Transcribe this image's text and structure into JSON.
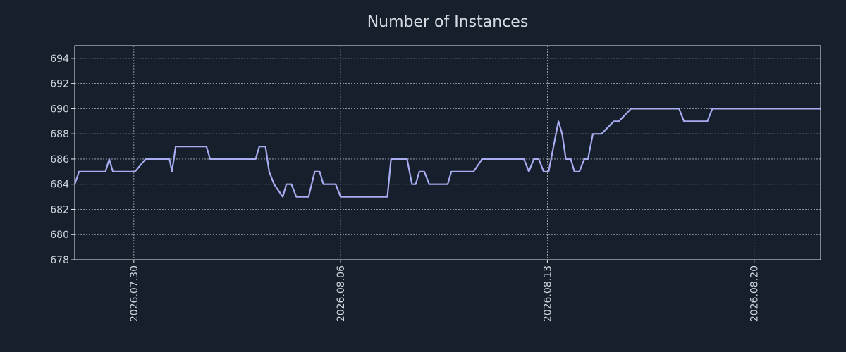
{
  "colors": {
    "background": "#161f2c",
    "line": "#a9acf0",
    "grid": "#d6dbe3",
    "axis": "#e6e9ee",
    "text": "#cfd5de"
  },
  "chart_data": {
    "type": "line",
    "title": "Number of Instances",
    "xlabel": "",
    "ylabel": "",
    "grid": true,
    "legend": "none",
    "xlim": [
      "2026-07-28T00:00",
      "2026-08-22T06:00"
    ],
    "ylim": [
      678,
      695
    ],
    "y_ticks": [
      678,
      680,
      682,
      684,
      686,
      688,
      690,
      692,
      694
    ],
    "x_ticks": [
      "2026.07.30",
      "2026.08.06",
      "2026.08.13",
      "2026.08.20"
    ],
    "series": [
      {
        "name": "",
        "x": [
          "2026-07-28T00:00",
          "2026-07-28T03:30",
          "2026-07-28T10:00",
          "2026-07-29T01:00",
          "2026-07-29T04:00",
          "2026-07-29T07:00",
          "2026-07-29T18:00",
          "2026-07-30T01:00",
          "2026-07-30T09:30",
          "2026-07-31T05:00",
          "2026-07-31T07:00",
          "2026-07-31T10:00",
          "2026-07-31T13:00",
          "2026-08-01T11:00",
          "2026-08-01T14:00",
          "2026-08-03T03:00",
          "2026-08-03T06:00",
          "2026-08-03T11:00",
          "2026-08-03T14:00",
          "2026-08-03T18:00",
          "2026-08-04T01:00",
          "2026-08-04T04:00",
          "2026-08-04T08:00",
          "2026-08-04T12:00",
          "2026-08-04T22:00",
          "2026-08-05T03:00",
          "2026-08-05T07:00",
          "2026-08-05T10:00",
          "2026-08-05T13:00",
          "2026-08-05T20:00",
          "2026-08-06T00:00",
          "2026-08-06T07:00",
          "2026-08-06T10:00",
          "2026-08-07T14:00",
          "2026-08-07T17:00",
          "2026-08-08T06:00",
          "2026-08-08T10:00",
          "2026-08-08T13:00",
          "2026-08-08T16:00",
          "2026-08-08T20:00",
          "2026-08-09T00:00",
          "2026-08-09T15:00",
          "2026-08-09T18:00",
          "2026-08-10T12:00",
          "2026-08-10T19:00",
          "2026-08-12T05:00",
          "2026-08-12T09:00",
          "2026-08-12T13:00",
          "2026-08-12T17:00",
          "2026-08-12T21:00",
          "2026-08-13T01:00",
          "2026-08-13T09:00",
          "2026-08-13T12:00",
          "2026-08-13T15:00",
          "2026-08-13T19:00",
          "2026-08-13T22:00",
          "2026-08-14T02:00",
          "2026-08-14T06:00",
          "2026-08-14T09:00",
          "2026-08-14T13:00",
          "2026-08-14T16:00",
          "2026-08-14T20:00",
          "2026-08-15T06:00",
          "2026-08-15T10:00",
          "2026-08-15T20:00",
          "2026-08-16T00:00",
          "2026-08-17T11:00",
          "2026-08-17T15:00",
          "2026-08-18T10:00",
          "2026-08-18T14:00",
          "2026-08-22T06:00"
        ],
        "values": [
          684,
          685,
          685,
          685,
          686,
          685,
          685,
          685,
          686,
          686,
          685,
          687,
          687,
          687,
          686,
          686,
          687,
          687,
          685,
          684,
          683,
          684,
          684,
          683,
          683,
          685,
          685,
          684,
          684,
          684,
          683,
          683,
          683,
          683,
          686,
          686,
          684,
          684,
          685,
          685,
          684,
          684,
          685,
          685,
          686,
          686,
          685,
          686,
          686,
          685,
          685,
          689,
          688,
          686,
          686,
          685,
          685,
          686,
          686,
          688,
          688,
          688,
          689,
          689,
          690,
          690,
          690,
          689,
          689,
          690,
          690
        ]
      }
    ]
  }
}
